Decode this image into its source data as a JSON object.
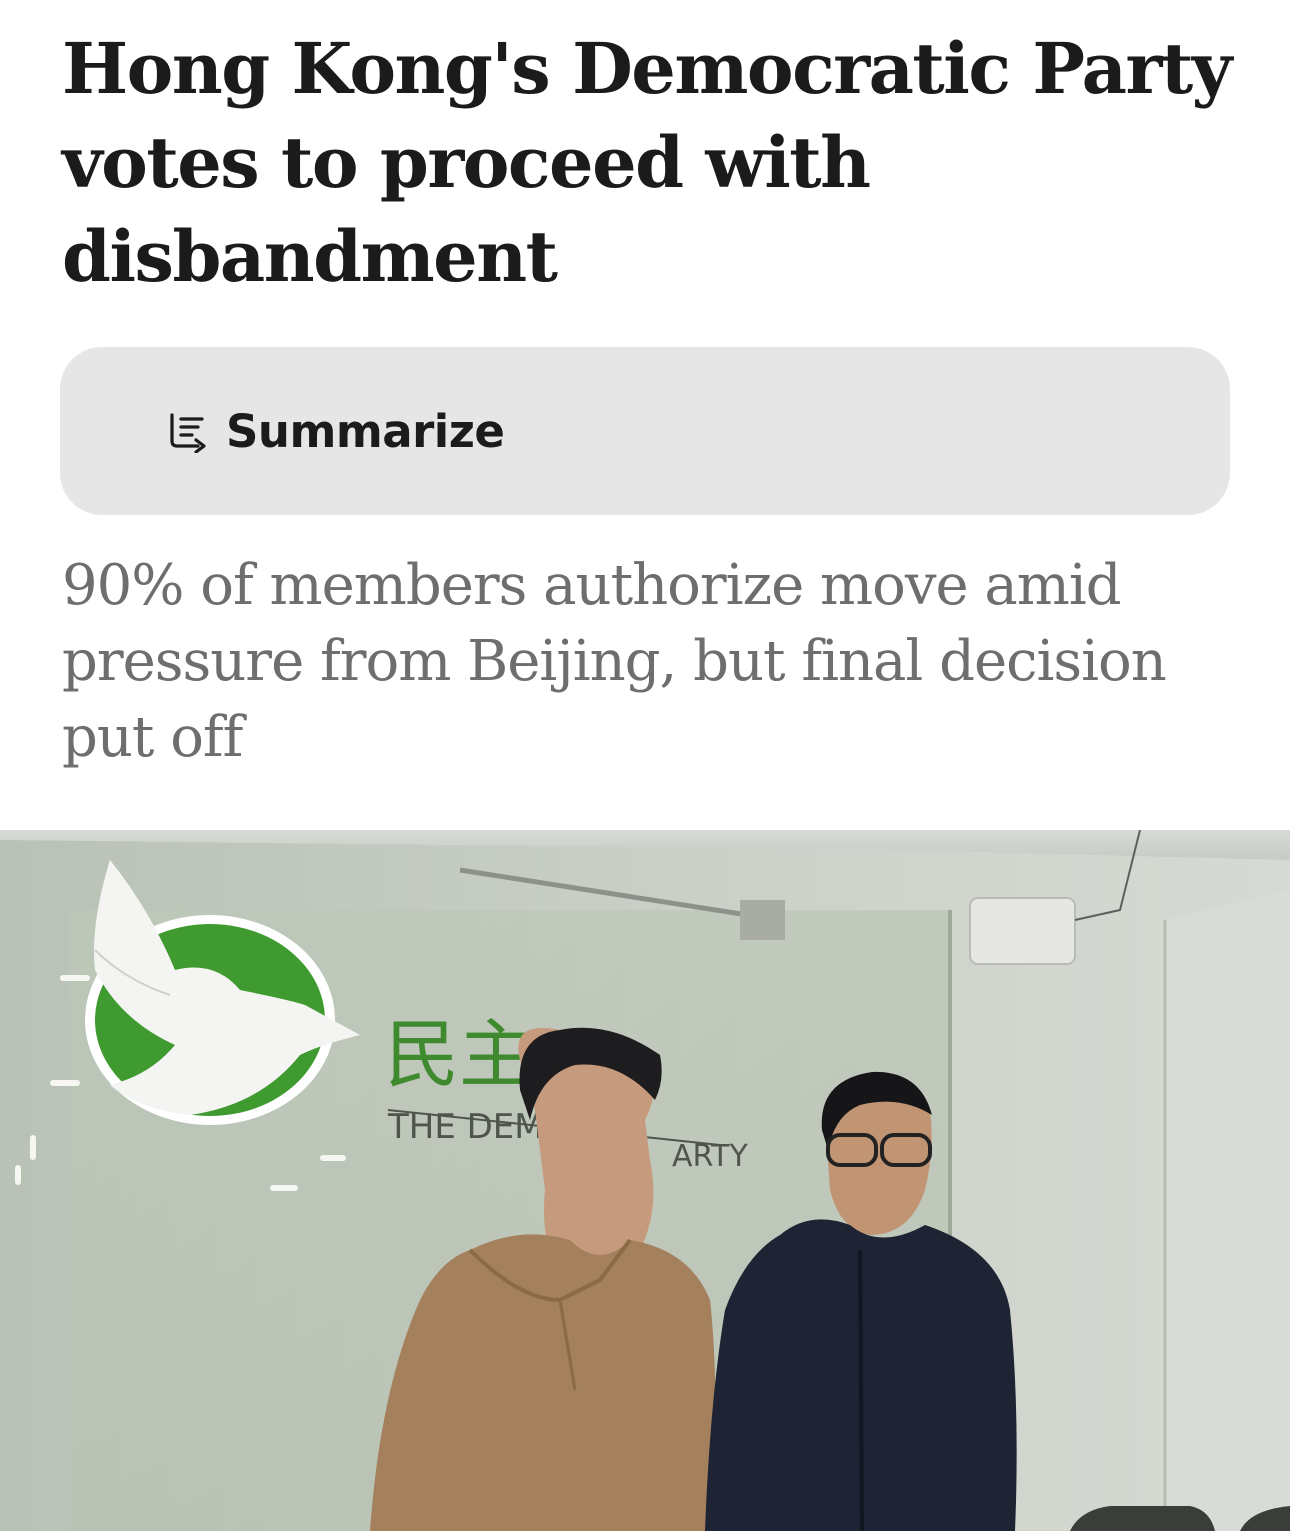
{
  "article": {
    "headline": "Hong Kong's Democratic Party votes to proceed with disbandment",
    "summarize_label": "Summarize",
    "summarize_icon": "summarize-icon",
    "standfirst": "90% of members authorize move amid pressure from Beijing, but final decision put off"
  },
  "photo": {
    "sign_chinese": "民主",
    "sign_english_left": "THE DEM",
    "sign_english_right": "ARTY"
  },
  "colors": {
    "headline": "#1b1b1b",
    "standfirst": "#6e6e6e",
    "button_background": "#e6e6e6",
    "logo_green": "#3f9a2f"
  }
}
